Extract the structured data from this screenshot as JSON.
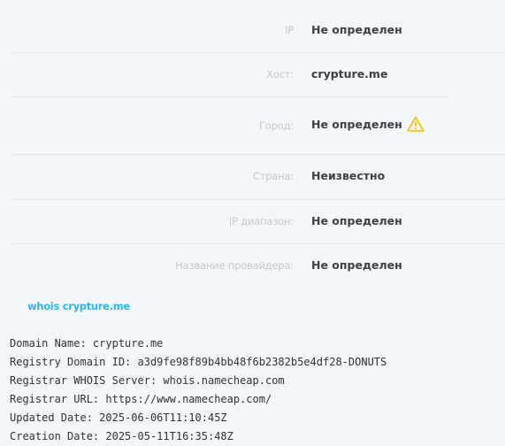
{
  "info": {
    "rows": [
      {
        "label": "IP",
        "value": "Не определен"
      },
      {
        "label": "Хост:",
        "value": "crypture.me"
      },
      {
        "label": "Город:",
        "value": "Не определен"
      },
      {
        "label": "Страна:",
        "value": "Неизвестно"
      },
      {
        "label": "IP диапазон:",
        "value": "Не определен"
      },
      {
        "label": "Название провайдера:",
        "value": "Не определен"
      }
    ],
    "warning_icon": "warning-triangle-icon",
    "warning_color": "#f0c92c"
  },
  "whois": {
    "link_label": "whois crypture.me",
    "link_color": "#33b5e5",
    "lines": [
      "Domain Name: crypture.me",
      "Registry Domain ID: a3d9fe98f89b4bb48f6b2382b5e4df28-DONUTS",
      "Registrar WHOIS Server: whois.namecheap.com",
      "Registrar URL: https://www.namecheap.com/",
      "Updated Date: 2025-06-06T11:10:45Z",
      "Creation Date: 2025-05-11T16:35:48Z"
    ]
  }
}
